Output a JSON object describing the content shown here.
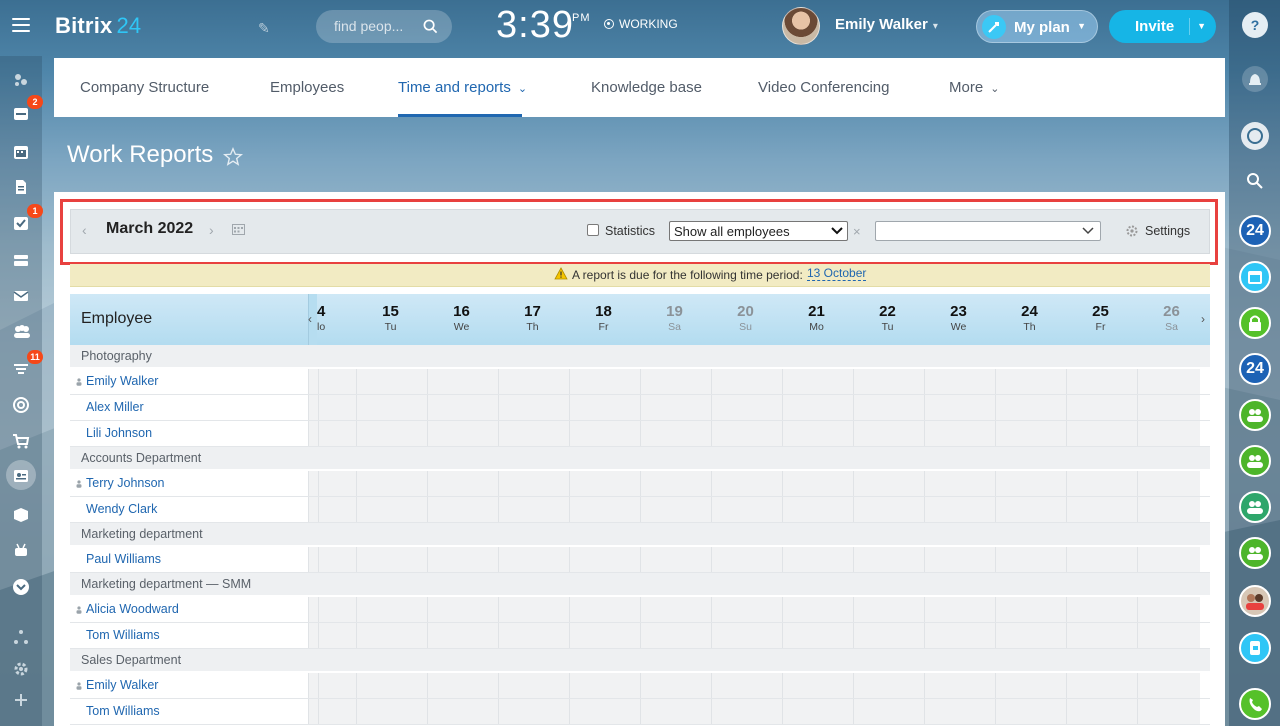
{
  "header": {
    "logo_text": "Bitrix",
    "logo_number": "24",
    "search_placeholder": "find peop...",
    "time": "3:39",
    "time_suffix": "PM",
    "status": "WORKING",
    "user_name": "Emily Walker",
    "myplan_label": "My plan",
    "invite_label": "Invite"
  },
  "sidebar_left": {
    "badges": [
      "2",
      "1",
      "11"
    ]
  },
  "sidebar_right": {
    "icons": [
      "help-icon",
      "bell-icon",
      "chat-icon",
      "search-icon",
      "b24-icon",
      "calendar-icon",
      "lock-icon",
      "b24-icon",
      "group-icon",
      "group-icon",
      "group-icon",
      "group-icon",
      "avatars-icon",
      "phone-transfer-icon",
      "phone-icon"
    ],
    "b24_label": "24"
  },
  "nav": {
    "tabs": [
      {
        "label": "Company Structure"
      },
      {
        "label": "Employees"
      },
      {
        "label": "Time and reports"
      },
      {
        "label": "Knowledge base"
      },
      {
        "label": "Video Conferencing"
      },
      {
        "label": "More"
      }
    ]
  },
  "page_title": "Work Reports",
  "toolbar": {
    "prev": "‹",
    "month": "March 2022",
    "next": "›",
    "statistics_label": "Statistics",
    "employee_filter": "Show all employees",
    "clear": "×",
    "settings_label": "Settings"
  },
  "notice": {
    "text": "A report is due for the following time period:",
    "link": "13 October"
  },
  "grid": {
    "employee_header": "Employee",
    "days": [
      {
        "d": "4",
        "w": "lo",
        "weekend": false
      },
      {
        "d": "15",
        "w": "Tu",
        "weekend": false
      },
      {
        "d": "16",
        "w": "We",
        "weekend": false
      },
      {
        "d": "17",
        "w": "Th",
        "weekend": false
      },
      {
        "d": "18",
        "w": "Fr",
        "weekend": false
      },
      {
        "d": "19",
        "w": "Sa",
        "weekend": true
      },
      {
        "d": "20",
        "w": "Su",
        "weekend": true
      },
      {
        "d": "21",
        "w": "Mo",
        "weekend": false
      },
      {
        "d": "22",
        "w": "Tu",
        "weekend": false
      },
      {
        "d": "23",
        "w": "We",
        "weekend": false
      },
      {
        "d": "24",
        "w": "Th",
        "weekend": false
      },
      {
        "d": "25",
        "w": "Fr",
        "weekend": false
      },
      {
        "d": "26",
        "w": "Sa",
        "weekend": true
      }
    ],
    "rows": [
      {
        "type": "dept",
        "label": "Photography"
      },
      {
        "type": "emp",
        "label": "Emily Walker",
        "manager": true
      },
      {
        "type": "emp",
        "label": "Alex Miller",
        "manager": false
      },
      {
        "type": "emp",
        "label": "Lili Johnson",
        "manager": false
      },
      {
        "type": "dept",
        "label": "Accounts Department"
      },
      {
        "type": "emp",
        "label": "Terry Johnson",
        "manager": true
      },
      {
        "type": "emp",
        "label": "Wendy Clark",
        "manager": false
      },
      {
        "type": "dept",
        "label": "Marketing department"
      },
      {
        "type": "emp",
        "label": "Paul Williams",
        "manager": false
      },
      {
        "type": "dept",
        "label": "Marketing department  —  SMM"
      },
      {
        "type": "emp",
        "label": "Alicia Woodward",
        "manager": true
      },
      {
        "type": "emp",
        "label": "Tom Williams",
        "manager": false
      },
      {
        "type": "dept",
        "label": "Sales Department"
      },
      {
        "type": "emp",
        "label": "Emily Walker",
        "manager": true
      },
      {
        "type": "emp",
        "label": "Tom Williams",
        "manager": false
      }
    ]
  },
  "colors": {
    "accent": "#2067b0",
    "highlight_border": "#e8413f",
    "invite": "#16b5e6",
    "badge": "#f54819"
  }
}
